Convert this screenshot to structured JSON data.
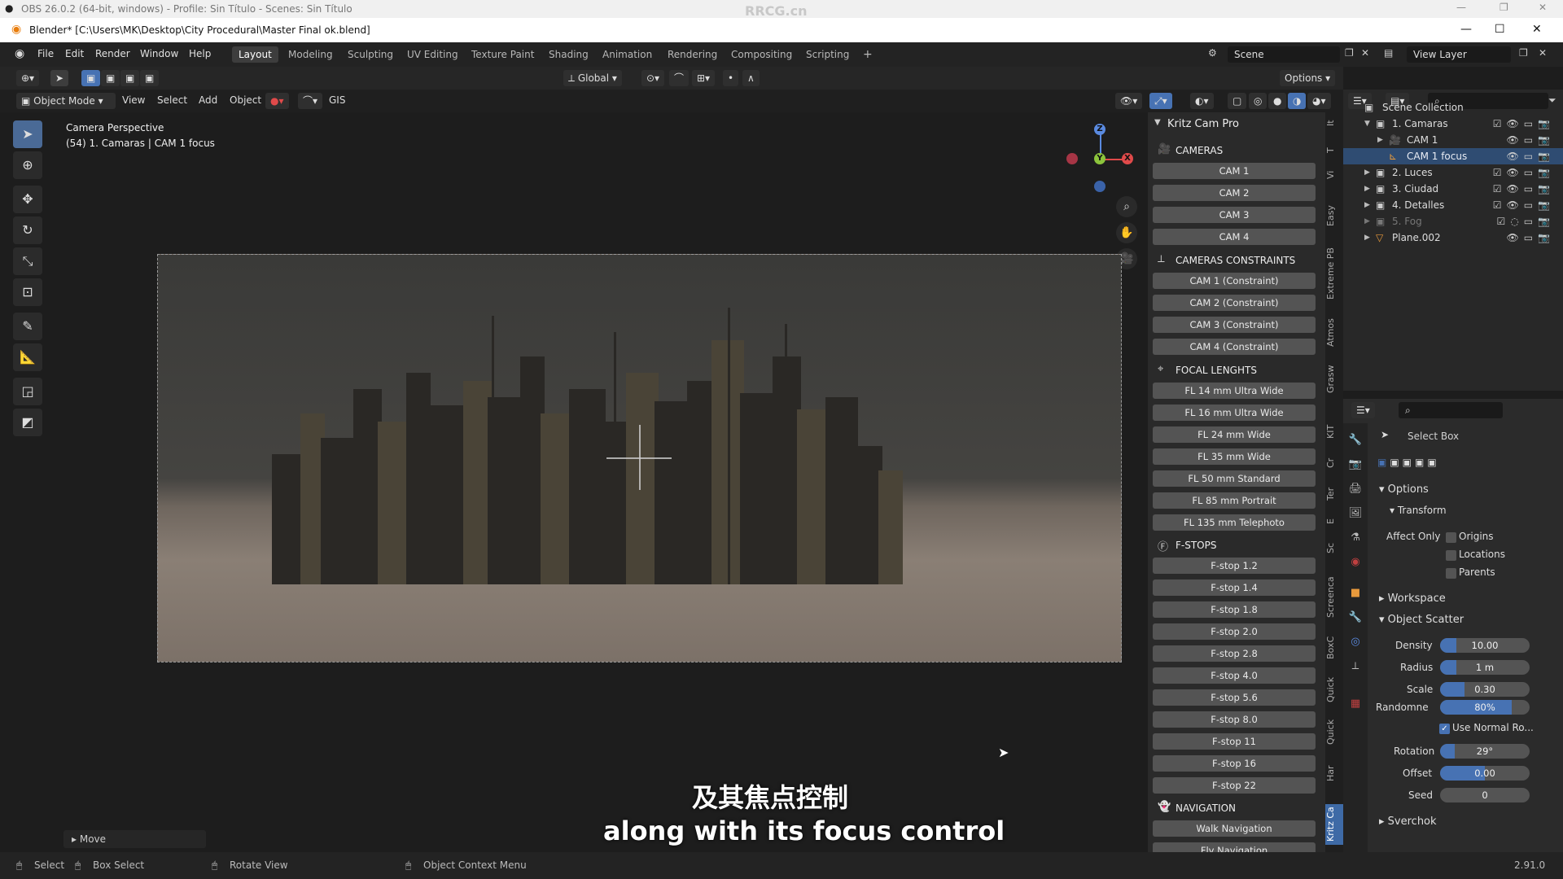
{
  "obs": {
    "title": "OBS 26.0.2 (64-bit, windows) - Profile: Sin Título - Scenes: Sin Título",
    "watermark": "RRCG.cn"
  },
  "window": {
    "title": "Blender* [C:\\Users\\MK\\Desktop\\City Procedural\\Master Final ok.blend]"
  },
  "menu": [
    "File",
    "Edit",
    "Render",
    "Window",
    "Help"
  ],
  "workspaces": [
    "Layout",
    "Modeling",
    "Sculpting",
    "UV Editing",
    "Texture Paint",
    "Shading",
    "Animation",
    "Rendering",
    "Compositing",
    "Scripting"
  ],
  "active_workspace": "Layout",
  "scene": {
    "name": "Scene",
    "view_layer": "View Layer"
  },
  "tool_header": {
    "orientation": "Global",
    "options": "Options"
  },
  "viewport_header": {
    "mode": "Object Mode",
    "view": "View",
    "select": "Select",
    "add": "Add",
    "object": "Object",
    "gis": "GIS"
  },
  "viewport": {
    "info_line1": "Camera Perspective",
    "info_line2": "(54) 1. Camaras | CAM 1 focus",
    "gizmo": {
      "z": "Z",
      "y": "Y",
      "x": "X"
    }
  },
  "move_panel": "Move",
  "subtitles": {
    "cn": "及其焦点控制",
    "en": "along with its focus control"
  },
  "kritz": {
    "title": "Kritz Cam Pro",
    "cameras_label": "CAMERAS",
    "cameras": [
      "CAM 1",
      "CAM 2",
      "CAM 3",
      "CAM 4"
    ],
    "constraints_label": "CAMERAS CONSTRAINTS",
    "constraints": [
      "CAM 1 (Constraint)",
      "CAM 2 (Constraint)",
      "CAM 3 (Constraint)",
      "CAM 4 (Constraint)"
    ],
    "focal_label": "FOCAL LENGHTS",
    "focal": [
      "FL 14 mm Ultra Wide",
      "FL 16 mm Ultra Wide",
      "FL 24 mm Wide",
      "FL 35 mm Wide",
      "FL 50 mm Standard",
      "FL 85 mm Portrait",
      "FL 135 mm Telephoto"
    ],
    "fstops_label": "F-STOPS",
    "fstops": [
      "F-stop 1.2",
      "F-stop 1.4",
      "F-stop 1.8",
      "F-stop 2.0",
      "F-stop 2.8",
      "F-stop 4.0",
      "F-stop 5.6",
      "F-stop 8.0",
      "F-stop 11",
      "F-stop 16",
      "F-stop 22"
    ],
    "navigation_label": "NAVIGATION",
    "navigation": [
      "Walk Navigation",
      "Fly Navigation"
    ]
  },
  "side_tabs": [
    "It",
    "T",
    "Vi",
    "Easy",
    "Extreme PB",
    "Atmos",
    "Grasw",
    "KIT",
    "Cr",
    "Ter",
    "E",
    "Sc",
    "Screenca",
    "BoxC",
    "Quick",
    "Quick",
    "Har",
    "Kritz Ca"
  ],
  "outliner": {
    "root": "Scene Collection",
    "items": [
      {
        "label": "1. Camaras",
        "dim": false
      },
      {
        "label": "CAM 1",
        "dim": false
      },
      {
        "label": "CAM 1 focus",
        "dim": false
      },
      {
        "label": "2. Luces",
        "dim": false
      },
      {
        "label": "3. Ciudad",
        "dim": false
      },
      {
        "label": "4. Detalles",
        "dim": false
      },
      {
        "label": "5. Fog",
        "dim": true
      },
      {
        "label": "Plane.002",
        "dim": false
      }
    ]
  },
  "properties": {
    "tool": "Select Box",
    "options": "Options",
    "transform": "Transform",
    "affect_only": "Affect Only",
    "origins": "Origins",
    "locations": "Locations",
    "parents": "Parents",
    "workspace": "Workspace",
    "object_scatter": "Object Scatter",
    "density_label": "Density",
    "density": "10.00",
    "radius_label": "Radius",
    "radius": "1 m",
    "scale_label": "Scale",
    "scale": "0.30",
    "randomness_label": "Randomne",
    "randomness": "80%",
    "use_normal": "Use Normal Ro...",
    "rotation_label": "Rotation",
    "rotation": "29°",
    "offset_label": "Offset",
    "offset": "0.00",
    "seed_label": "Seed",
    "seed": "0",
    "sverchok": "Sverchok"
  },
  "statusbar": {
    "select": "Select",
    "box_select": "Box Select",
    "rotate_view": "Rotate View",
    "context_menu": "Object Context Menu",
    "version": "2.91.0"
  },
  "colors": {
    "accent": "#4772b3",
    "selected_row": "#2f4c72",
    "button": "#545454",
    "panel": "#2a2a2a"
  }
}
